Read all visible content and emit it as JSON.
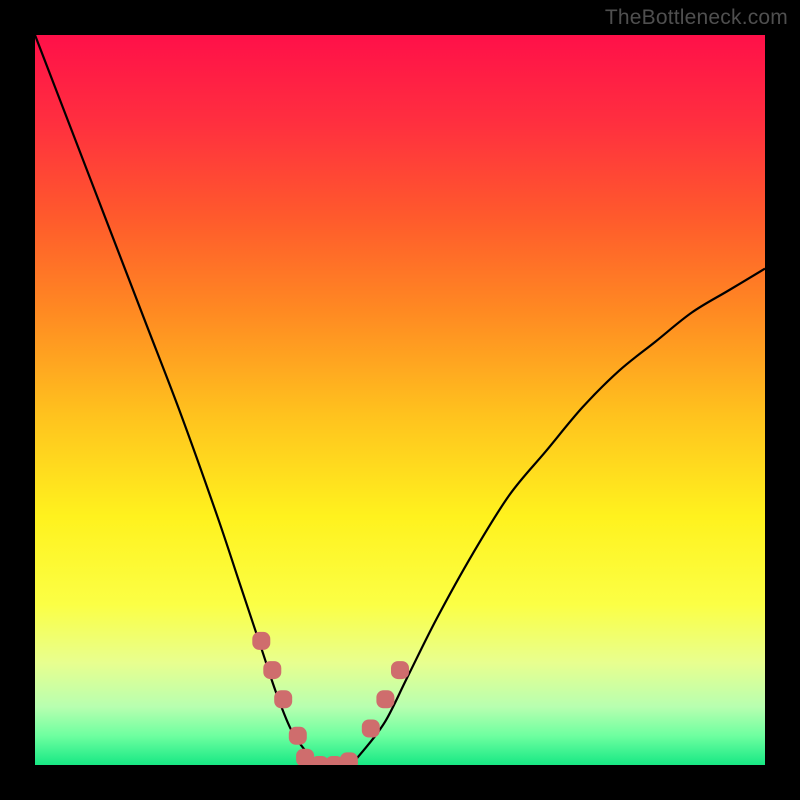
{
  "watermark": "TheBottleneck.com",
  "chart_data": {
    "type": "line",
    "title": "",
    "xlabel": "",
    "ylabel": "",
    "xlim": [
      0,
      100
    ],
    "ylim": [
      0,
      100
    ],
    "grid": false,
    "legend": false,
    "series": [
      {
        "name": "bottleneck-curve",
        "x": [
          0,
          5,
          10,
          15,
          20,
          25,
          28,
          31,
          33,
          35,
          37,
          39,
          41,
          43,
          45,
          48,
          51,
          55,
          60,
          65,
          70,
          75,
          80,
          85,
          90,
          95,
          100
        ],
        "y": [
          100,
          87,
          74,
          61,
          48,
          34,
          25,
          16,
          10,
          5,
          2,
          0,
          0,
          0,
          2,
          6,
          12,
          20,
          29,
          37,
          43,
          49,
          54,
          58,
          62,
          65,
          68
        ],
        "color": "#000000"
      }
    ],
    "annotations": [
      {
        "type": "marker-cluster",
        "name": "valley-markers-left",
        "points_x": [
          31,
          32.5,
          34,
          36
        ],
        "points_y": [
          17,
          13,
          9,
          4
        ],
        "color": "#cf6d6d"
      },
      {
        "type": "marker-cluster",
        "name": "valley-markers-bottom",
        "points_x": [
          37,
          39,
          41,
          43
        ],
        "points_y": [
          1,
          0,
          0,
          0.5
        ],
        "color": "#cf6d6d"
      },
      {
        "type": "marker-cluster",
        "name": "valley-markers-right",
        "points_x": [
          46,
          48,
          50
        ],
        "points_y": [
          5,
          9,
          13
        ],
        "color": "#cf6d6d"
      }
    ],
    "background_gradient": {
      "stops": [
        {
          "pos": 0.0,
          "color": "#ff1049"
        },
        {
          "pos": 0.12,
          "color": "#ff2f3f"
        },
        {
          "pos": 0.25,
          "color": "#ff5a2c"
        },
        {
          "pos": 0.38,
          "color": "#ff8a22"
        },
        {
          "pos": 0.52,
          "color": "#ffc21e"
        },
        {
          "pos": 0.66,
          "color": "#fff21e"
        },
        {
          "pos": 0.78,
          "color": "#fbff45"
        },
        {
          "pos": 0.86,
          "color": "#e8ff8f"
        },
        {
          "pos": 0.92,
          "color": "#b8ffb0"
        },
        {
          "pos": 0.96,
          "color": "#6effa0"
        },
        {
          "pos": 1.0,
          "color": "#17e884"
        }
      ]
    }
  }
}
